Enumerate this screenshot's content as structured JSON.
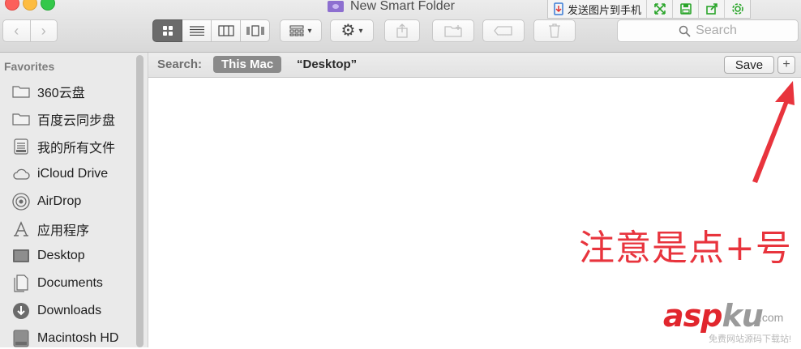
{
  "window": {
    "title": "New Smart Folder"
  },
  "extension_bar": {
    "send_label": "发送图片到手机"
  },
  "toolbar": {
    "search_placeholder": "Search"
  },
  "sidebar": {
    "heading": "Favorites",
    "items": [
      {
        "label": "360云盘",
        "icon": "folder-icon"
      },
      {
        "label": "百度云同步盘",
        "icon": "folder-icon"
      },
      {
        "label": "我的所有文件",
        "icon": "all-files-icon"
      },
      {
        "label": "iCloud Drive",
        "icon": "cloud-icon"
      },
      {
        "label": "AirDrop",
        "icon": "airdrop-icon"
      },
      {
        "label": "应用程序",
        "icon": "applications-icon"
      },
      {
        "label": "Desktop",
        "icon": "desktop-icon"
      },
      {
        "label": "Documents",
        "icon": "documents-icon"
      },
      {
        "label": "Downloads",
        "icon": "downloads-icon"
      },
      {
        "label": "Macintosh HD",
        "icon": "hard-drive-icon"
      }
    ]
  },
  "searchbar": {
    "label": "Search:",
    "scope_this_mac": "This Mac",
    "scope_desktop": "“Desktop”",
    "save_label": "Save",
    "plus_label": "+"
  },
  "annotation": {
    "text": "注意是点+号",
    "color": "#e8343d"
  },
  "watermark": {
    "main_a": "asp",
    "main_b": "ku",
    "suffix": ".com",
    "sub": "免费网站源码下载站!"
  }
}
